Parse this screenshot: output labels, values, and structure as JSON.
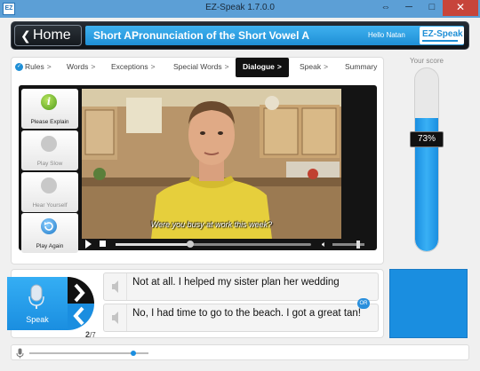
{
  "window": {
    "title": "EZ-Speak 1.7.0.0",
    "app_icon_label": "EZ",
    "resize_glyph": "⇔",
    "minimize_glyph": "─",
    "maximize_glyph": "□",
    "close_glyph": "✕"
  },
  "header": {
    "home_label": "Home",
    "home_arrow": "❮",
    "lesson_prefix": "Short A:",
    "lesson_title": "Pronunciation of the Short Vowel A",
    "greeting": "Hello Natan",
    "logo": "EZ-Speak"
  },
  "tabs": [
    {
      "label": "Rules",
      "sep": ">"
    },
    {
      "label": "Words",
      "sep": ">"
    },
    {
      "label": "Exceptions",
      "sep": ">"
    },
    {
      "label": "Special Words",
      "sep": ">"
    },
    {
      "label": "Dialogue",
      "sep": ">"
    },
    {
      "label": "Speak",
      "sep": ">"
    },
    {
      "label": "Summary",
      "sep": ""
    }
  ],
  "side_buttons": [
    {
      "label": "Please Explain",
      "icon": "info-icon",
      "enabled": true
    },
    {
      "label": "Play Slow",
      "icon": "snail-icon",
      "enabled": false
    },
    {
      "label": "Hear Yourself",
      "icon": "headphones-icon",
      "enabled": false
    },
    {
      "label": "Play Again",
      "icon": "replay-icon",
      "enabled": true
    }
  ],
  "video": {
    "subtitle": "Were you busy at work this week?",
    "progress": 0.38,
    "volume": 0.8
  },
  "score": {
    "label": "Your score",
    "value": "73%",
    "fraction": 0.73
  },
  "speak": {
    "label": "Speak",
    "page_current": "2",
    "page_total": "/7",
    "or_label": "OR"
  },
  "answers": [
    {
      "text": "Not at all. I helped my sister plan her wedding"
    },
    {
      "text": "No, I had time to go to the beach. I got a great tan!"
    }
  ],
  "mic_level": 0.85,
  "colors": {
    "accent": "#1a8ee0",
    "header_bg": "#15191e",
    "title_bar": "#5c9fd6",
    "close": "#c7453b"
  }
}
